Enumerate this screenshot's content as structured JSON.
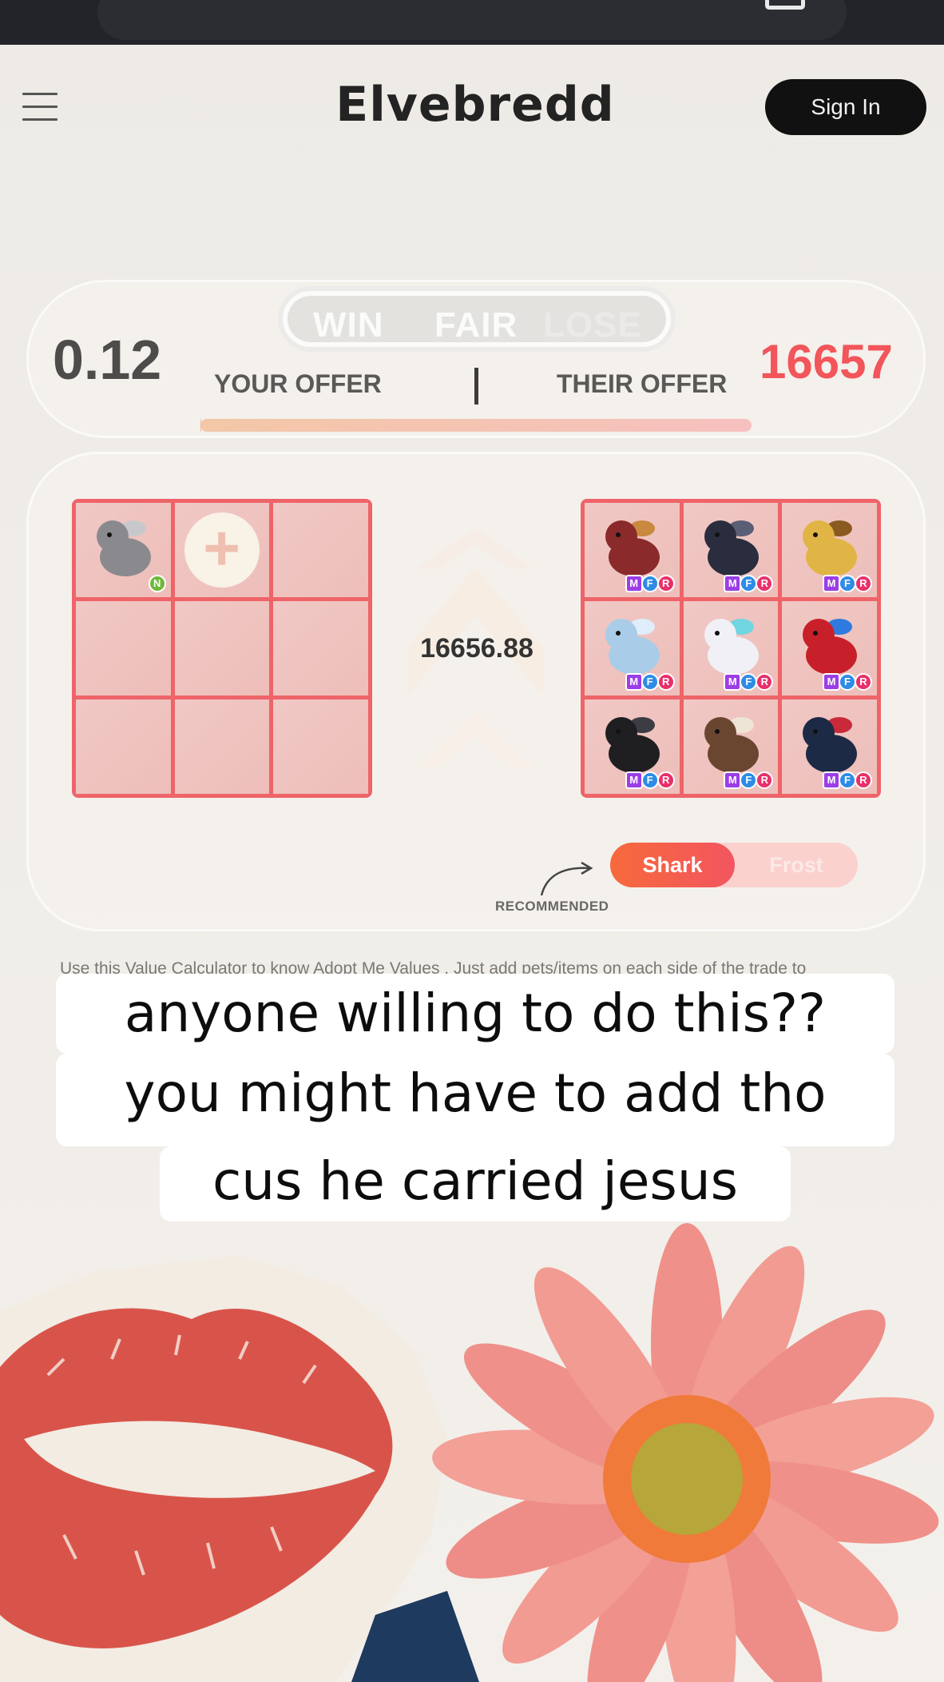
{
  "header": {
    "logo": "Elvebredd",
    "signin_label": "Sign In"
  },
  "summary": {
    "outcome_tabs": [
      "WIN",
      "FAIR",
      "LOSE"
    ],
    "your_value": "0.12",
    "their_value": "16657",
    "your_label": "YOUR OFFER",
    "their_label": "THEIR OFFER",
    "divider": "|",
    "balance_fraction": 0.001
  },
  "trade": {
    "difference": "16656.88",
    "your_items": [
      {
        "pet": "donkey",
        "badges": [
          "N"
        ]
      }
    ],
    "add_label": "+",
    "their_items": [
      {
        "pet": "bat-dragon",
        "badges": [
          "M",
          "F",
          "R"
        ]
      },
      {
        "pet": "shadow-dragon",
        "badges": [
          "M",
          "F",
          "R"
        ]
      },
      {
        "pet": "giraffe",
        "badges": [
          "M",
          "F",
          "R"
        ]
      },
      {
        "pet": "frost-dragon",
        "badges": [
          "M",
          "F",
          "R"
        ]
      },
      {
        "pet": "unicorn",
        "badges": [
          "M",
          "F",
          "R"
        ]
      },
      {
        "pet": "parrot",
        "badges": [
          "M",
          "F",
          "R"
        ]
      },
      {
        "pet": "crow",
        "badges": [
          "M",
          "F",
          "R"
        ]
      },
      {
        "pet": "owl",
        "badges": [
          "M",
          "F",
          "R"
        ]
      },
      {
        "pet": "evil-unicorn",
        "badges": [
          "M",
          "F",
          "R"
        ]
      }
    ],
    "recommended_label": "RECOMMENDED",
    "modes": [
      "Shark",
      "Frost"
    ],
    "active_mode": "Shark"
  },
  "description": "Use this Value Calculator to know Adopt Me Values . Just add pets/items on each side of the trade to",
  "caption": {
    "line1": "anyone willing to do this??",
    "line2": "you might have to add tho",
    "line3": "cus he carried jesus"
  },
  "colors": {
    "accent_red": "#f2555a",
    "grid_border": "#ee6469",
    "shark_gradient": "#f76a3b",
    "dark": "#111111"
  }
}
